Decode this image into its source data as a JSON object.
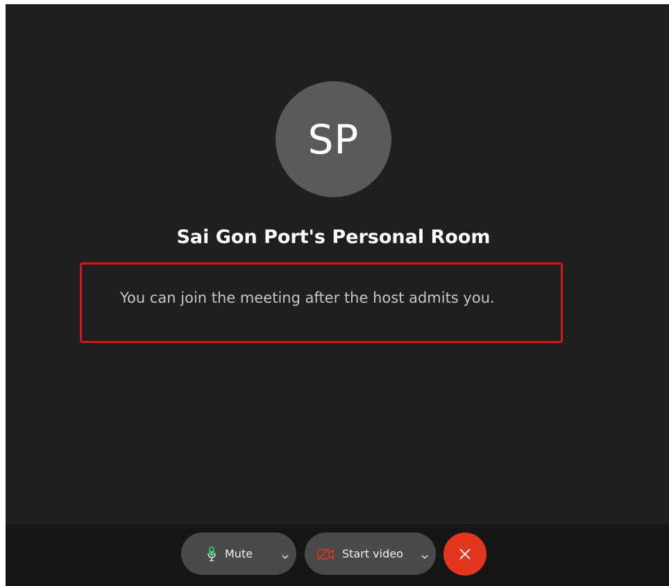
{
  "participant": {
    "initials": "SP",
    "avatar_color": "#5a5a5a"
  },
  "room": {
    "title": "Sai Gon Port's Personal Room"
  },
  "lobby": {
    "message": "You can join the meeting after the host admits you.",
    "highlight_color": "#e0141b"
  },
  "controls": {
    "mute": {
      "label": "Mute",
      "icon": "microphone-icon",
      "icon_color": "#3fd07a",
      "dropdown_icon": "chevron-down-icon"
    },
    "video": {
      "label": "Start video",
      "icon": "video-off-icon",
      "icon_color": "#e2361f",
      "dropdown_icon": "chevron-down-icon"
    },
    "leave": {
      "icon": "close-icon",
      "color": "#e2361f"
    }
  },
  "colors": {
    "background": "#1f1f1f",
    "control_bar": "#161616",
    "pill": "#4a4a4a"
  }
}
